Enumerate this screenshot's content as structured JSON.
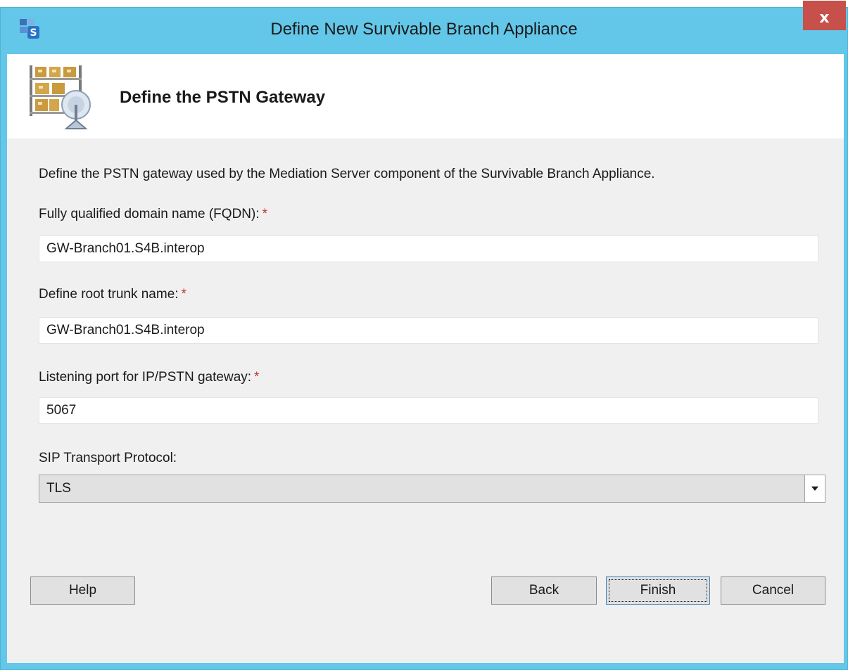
{
  "window": {
    "title": "Define New Survivable Branch Appliance",
    "close_label": "x"
  },
  "header": {
    "title": "Define the PSTN Gateway"
  },
  "description": "Define the PSTN gateway used by the Mediation Server component of the Survivable Branch Appliance.",
  "fields": {
    "fqdn": {
      "label": "Fully qualified domain name (FQDN):",
      "required_marker": "*",
      "value": "GW-Branch01.S4B.interop"
    },
    "root_trunk": {
      "label": "Define root trunk name:",
      "required_marker": "*",
      "value": "GW-Branch01.S4B.interop"
    },
    "listening_port": {
      "label": "Listening port for IP/PSTN gateway:",
      "required_marker": "*",
      "value": "5067"
    },
    "sip_transport": {
      "label": "SIP Transport Protocol:",
      "selected": "TLS"
    }
  },
  "buttons": {
    "help": "Help",
    "back": "Back",
    "finish": "Finish",
    "cancel": "Cancel"
  },
  "colors": {
    "titlebar": "#63c7e9",
    "close_button": "#c7504a",
    "required_asterisk": "#c0392b",
    "client_background": "#f0f0f0"
  },
  "icons": {
    "app": "lync-topology-icon",
    "header": "gateway-appliance-icon",
    "dropdown": "chevron-down-icon"
  }
}
